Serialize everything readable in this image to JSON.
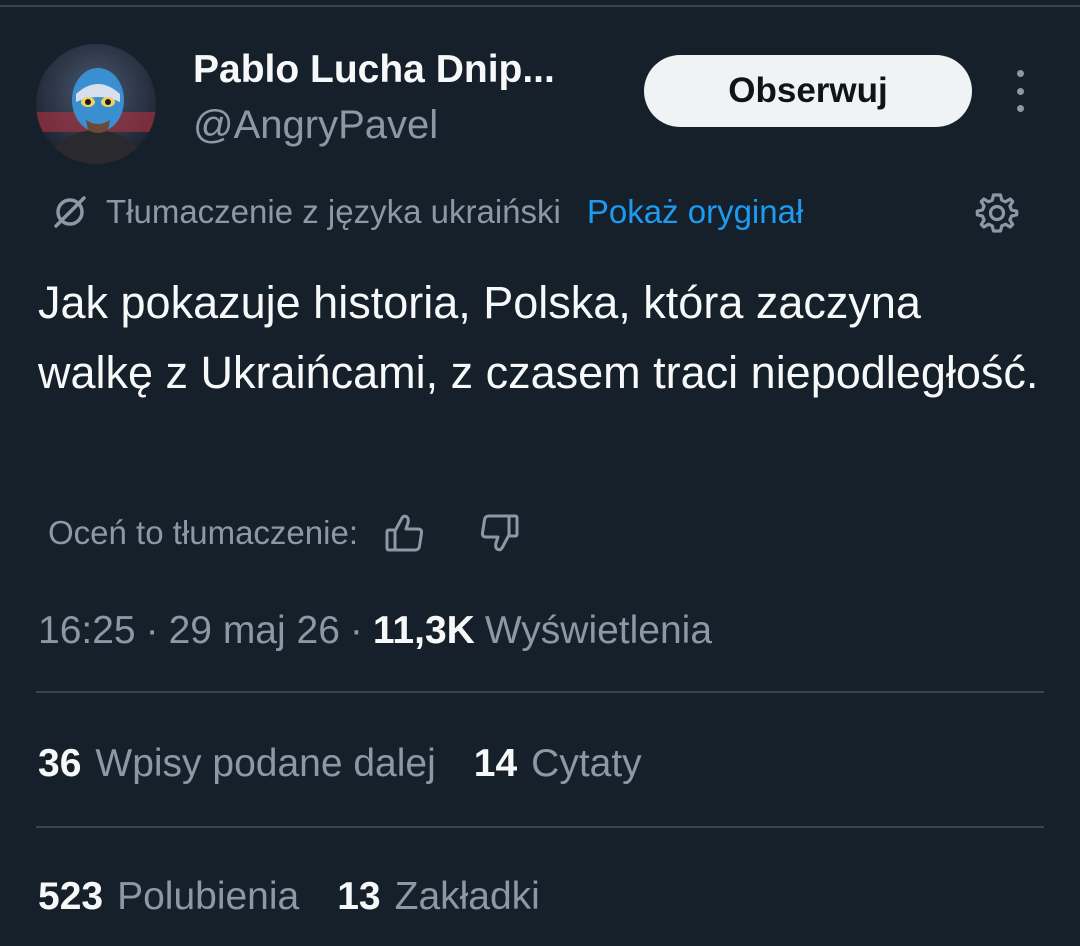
{
  "author": {
    "display_name": "Pablo Lucha Dnip...",
    "handle": "@AngryPavel"
  },
  "header": {
    "follow_label": "Obserwuj"
  },
  "translation": {
    "label": "Tłumaczenie z języka ukraiński",
    "show_original": "Pokaż oryginał"
  },
  "tweet": {
    "text": "Jak pokazuje historia, Polska, która zaczyna walkę z Ukraińcami, z czasem traci niepodległość."
  },
  "rating": {
    "label": "Oceń to tłumaczenie:"
  },
  "meta": {
    "time": "16:25",
    "date": "29 maj 26",
    "views_count": "11,3K",
    "views_label": "Wyświetlenia",
    "separator": "·"
  },
  "stats": {
    "reposts_count": "36",
    "reposts_label": "Wpisy podane dalej",
    "quotes_count": "14",
    "quotes_label": "Cytaty",
    "likes_count": "523",
    "likes_label": "Polubienia",
    "bookmarks_count": "13",
    "bookmarks_label": "Zakładki"
  },
  "colors": {
    "background": "#15202b",
    "text_primary": "#f7f9f9",
    "text_secondary": "#8b98a5",
    "link": "#1d9bf0",
    "divider": "#38444d"
  },
  "icons": [
    "translate-slash-icon",
    "gear-icon",
    "thumbs-up-icon",
    "thumbs-down-icon",
    "more-vertical-icon"
  ]
}
